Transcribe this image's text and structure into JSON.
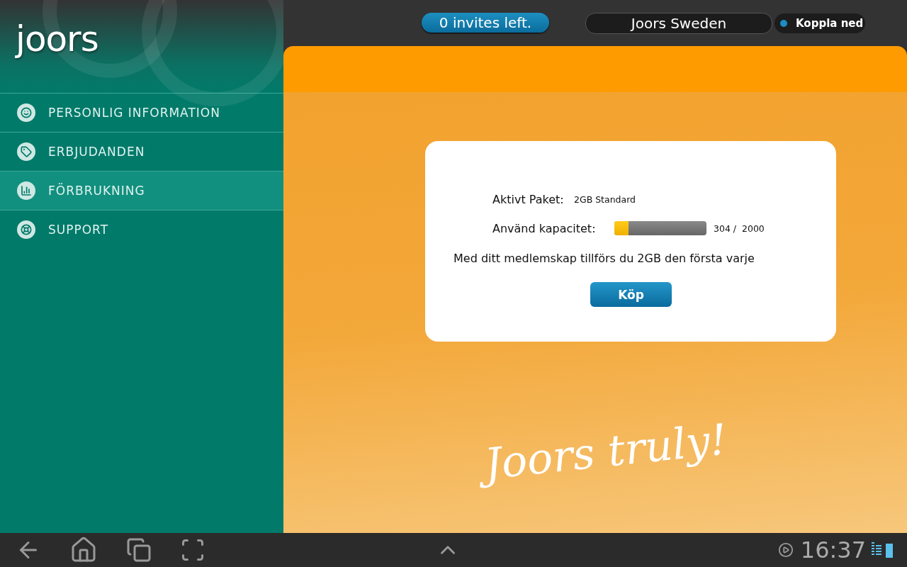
{
  "logo": "joors",
  "header": {
    "invites": "0 invites left.",
    "account": "Joors Sweden",
    "disconnect": "Koppla ned"
  },
  "sidebar": {
    "items": [
      {
        "label": "PERSONLIG INFORMATION",
        "selected": false
      },
      {
        "label": "ERBJUDANDEN",
        "selected": false
      },
      {
        "label": "FÖRBRUKNING",
        "selected": true
      },
      {
        "label": "SUPPORT",
        "selected": false
      }
    ]
  },
  "card": {
    "package_label": "Aktivt Paket:",
    "package_value": "2GB Standard",
    "capacity_label": "Använd kapacitet:",
    "capacity": {
      "level": 0.152,
      "reading": "304 /  2000"
    },
    "info": "Med ditt medlemskap tillförs du 2GB den första varje",
    "buy_button": "Köp"
  },
  "slogan": "Joors truly!",
  "status_bar": {
    "time": "16:37"
  }
}
